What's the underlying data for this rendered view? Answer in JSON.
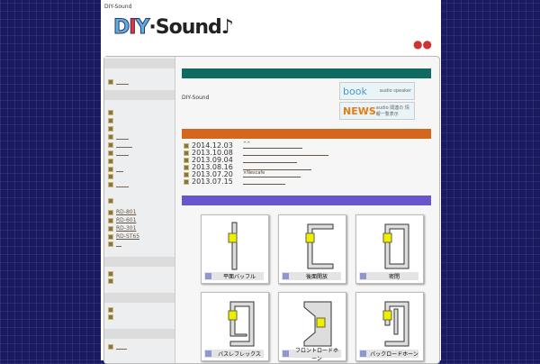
{
  "site_title": "DIY-Sound",
  "logo": {
    "text_d": "DIY",
    "text_sound": "Sound"
  },
  "intro": "DIY-Sound",
  "banners": [
    {
      "big": "book",
      "small": "audio speaker"
    },
    {
      "big": "NEWS",
      "small": "audio 関連の 情報一覧表示"
    }
  ],
  "sidebar": {
    "models": [
      "RD-801",
      "RD-601",
      "RD-301",
      "RD-ST65"
    ]
  },
  "news": [
    {
      "date": "2014.12.03",
      "title": "^^"
    },
    {
      "date": "2013.10.08",
      "title": ""
    },
    {
      "date": "2013.09.04",
      "title": ""
    },
    {
      "date": "2013.08.16",
      "title": ""
    },
    {
      "date": "2013.07.20",
      "title": "×Nescafe"
    },
    {
      "date": "2013.07.15",
      "title": ""
    }
  ],
  "tiles": [
    "平面バッフル",
    "後面開放",
    "密閉",
    "バスレフレックス",
    "フロントロードホーン",
    "バックロードホーン"
  ],
  "colors": {
    "teal": "#0f6b62",
    "orange": "#d4661e",
    "purple": "#6a56cc"
  }
}
